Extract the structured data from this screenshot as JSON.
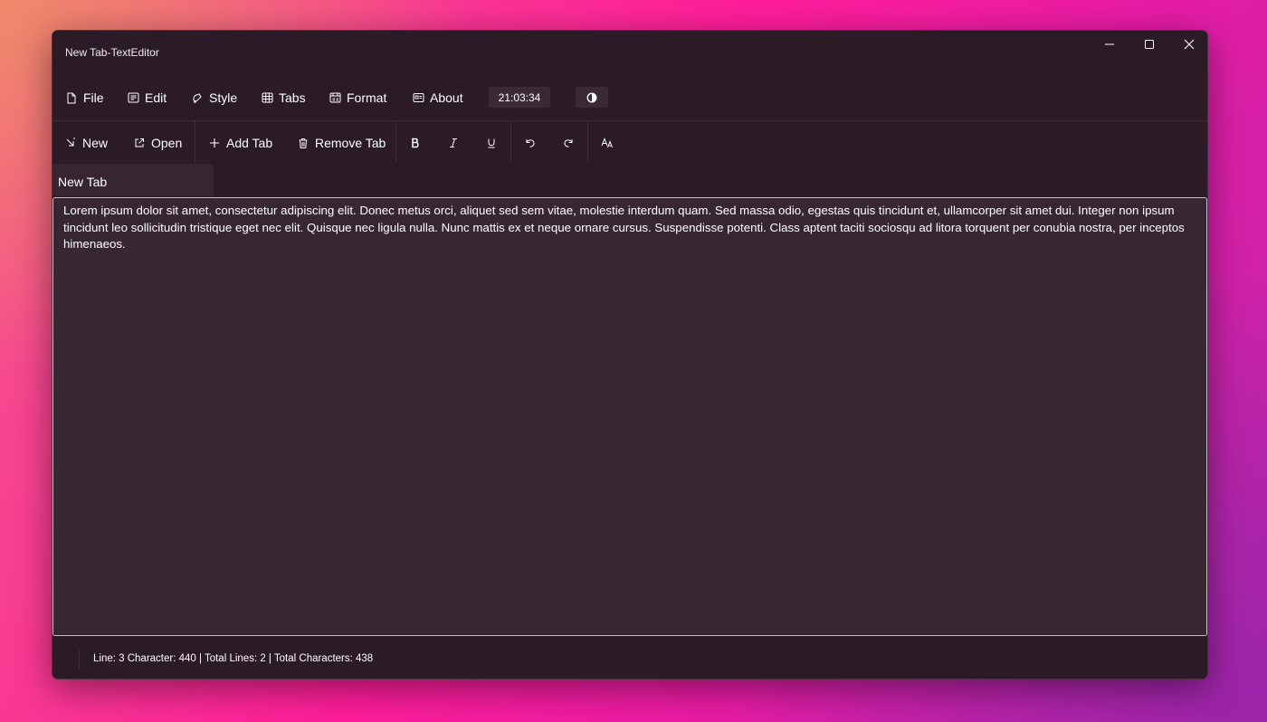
{
  "window": {
    "title": "New Tab-TextEditor"
  },
  "menu": {
    "items": [
      {
        "label": "File",
        "icon": "file-icon"
      },
      {
        "label": "Edit",
        "icon": "edit-icon"
      },
      {
        "label": "Style",
        "icon": "style-icon"
      },
      {
        "label": "Tabs",
        "icon": "tabs-icon"
      },
      {
        "label": "Format",
        "icon": "format-icon"
      },
      {
        "label": "About",
        "icon": "about-icon"
      }
    ],
    "clock": "21:03:34",
    "theme_toggle_icon": "contrast-icon"
  },
  "toolbar": {
    "new_label": "New",
    "open_label": "Open",
    "add_tab_label": "Add Tab",
    "remove_tab_label": "Remove Tab",
    "icons": [
      "bold-icon",
      "italic-icon",
      "underline-icon",
      "undo-icon",
      "redo-icon",
      "font-size-icon"
    ]
  },
  "tabs": [
    {
      "label": "New Tab"
    }
  ],
  "editor": {
    "text": "Lorem ipsum dolor sit amet, consectetur adipiscing elit. Donec metus orci, aliquet sed sem vitae, molestie interdum quam. Sed massa odio, egestas quis tincidunt et, ullamcorper sit amet dui. Integer non ipsum tincidunt leo sollicitudin tristique eget nec elit. Quisque nec ligula nulla. Nunc mattis ex et neque ornare cursus. Suspendisse potenti. Class aptent taciti sociosqu ad litora torquent per conubia nostra, per inceptos himenaeos."
  },
  "status": {
    "text": "Line: 3 Character: 440 | Total Lines: 2 | Total Characters: 438"
  },
  "colors": {
    "window_bg": "#2b1b27",
    "editor_bg": "#372732",
    "accent": "#ff1d9a"
  }
}
